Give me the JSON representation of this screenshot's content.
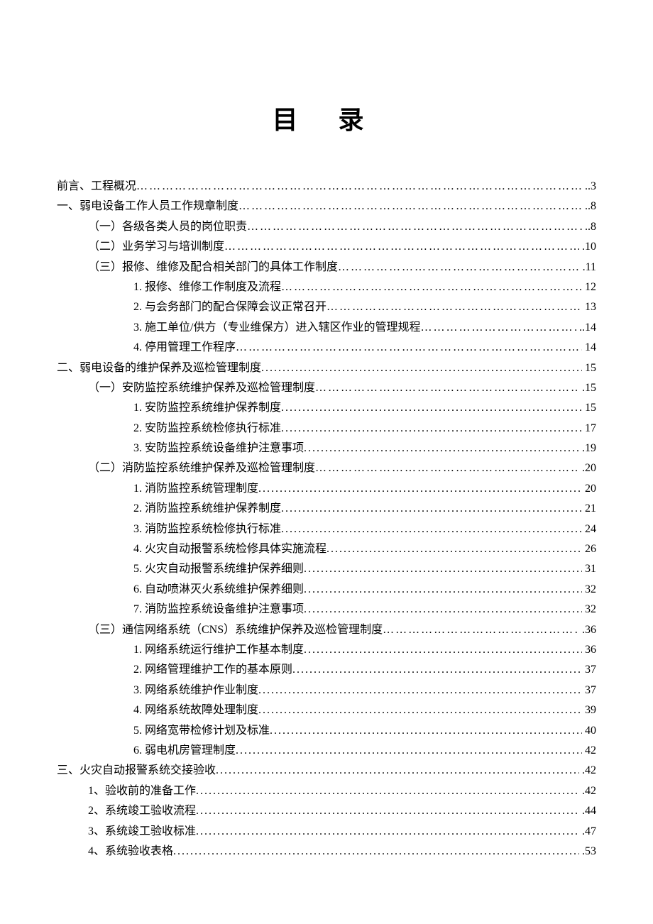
{
  "title": "目 录",
  "entries": [
    {
      "level": 0,
      "text": "前言、工程概况",
      "page": "3",
      "leader": "…",
      "pgprefix": ".."
    },
    {
      "level": 0,
      "text": "一、弱电设备工作人员工作规章制度",
      "page": "8",
      "leader": "…",
      "pgprefix": ".."
    },
    {
      "level": 1,
      "text": "（一）各级各类人员的岗位职责",
      "page": "8",
      "leader": "…",
      "pgprefix": ".."
    },
    {
      "level": 1,
      "text": "（二）业务学习与培训制度",
      "page": "10",
      "leader": "…",
      "pgprefix": "."
    },
    {
      "level": 1,
      "text": "（三）报修、维修及配合相关部门的具体工作制度",
      "page": "11",
      "leader": "…",
      "pgprefix": "."
    },
    {
      "level": 2,
      "text": "1.  报修、维修工作制度及流程",
      "page": "12",
      "leader": "…",
      "pgprefix": " "
    },
    {
      "level": 2,
      "text": "2.  与会务部门的配合保障会议正常召开",
      "page": "13",
      "leader": "…",
      "pgprefix": " "
    },
    {
      "level": 2,
      "text": "3.  施工单位/供方（专业维保方）进入辖区作业的管理规程",
      "page": "14",
      "leader": "…",
      "pgprefix": ".."
    },
    {
      "level": 2,
      "text": "4.  停用管理工作程序",
      "page": "14",
      "leader": "…",
      "pgprefix": " "
    },
    {
      "level": 0,
      "text": "二、弱电设备的维护保养及巡检管理制度",
      "page": "15",
      "leader": ".",
      "pgprefix": " "
    },
    {
      "level": 1,
      "text": "（一）安防监控系统维护保养及巡检管理制度",
      "page": "15",
      "leader": "…",
      "pgprefix": "."
    },
    {
      "level": 2,
      "text": "1.  安防监控系统维护保养制度",
      "page": "15",
      "leader": ".",
      "pgprefix": " "
    },
    {
      "level": 2,
      "text": "2.  安防监控系统检修执行标准",
      "page": "17",
      "leader": ".",
      "pgprefix": " "
    },
    {
      "level": 2,
      "text": "3.  安防监控系统设备维护注意事项",
      "page": "19",
      "leader": ".",
      "pgprefix": "."
    },
    {
      "level": 1,
      "text": "（二）消防监控系统维护保养及巡检管理制度",
      "page": "20",
      "leader": "…",
      "pgprefix": "."
    },
    {
      "level": 2,
      "text": "1.  消防监控系统管理制度",
      "page": "20",
      "leader": ".",
      "pgprefix": " "
    },
    {
      "level": 2,
      "text": "2.  消防监控系统维护保养制度",
      "page": "21",
      "leader": ".",
      "pgprefix": " "
    },
    {
      "level": 2,
      "text": "3.  消防监控系统检修执行标准",
      "page": "24",
      "leader": ".",
      "pgprefix": " "
    },
    {
      "level": 2,
      "text": "4.  火灾自动报警系统检修具体实施流程",
      "page": "26",
      "leader": ".",
      "pgprefix": " "
    },
    {
      "level": 2,
      "text": "5.  火灾自动报警系统维护保养细则",
      "page": "31",
      "leader": ".",
      "pgprefix": " "
    },
    {
      "level": 2,
      "text": "6.  自动喷淋灭火系统维护保养细则",
      "page": "32",
      "leader": ".",
      "pgprefix": " "
    },
    {
      "level": 2,
      "text": "7.  消防监控系统设备维护注意事项",
      "page": "32",
      "leader": ".",
      "pgprefix": " "
    },
    {
      "level": 1,
      "text": "（三）通信网络系统（CNS）系统维护保养及巡检管理制度",
      "page": "36",
      "leader": "…",
      "pgprefix": "."
    },
    {
      "level": 2,
      "text": "1.  网络系统运行维护工作基本制度",
      "page": "36",
      "leader": ".",
      "pgprefix": " "
    },
    {
      "level": 2,
      "text": "2.  网络管理维护工作的基本原则",
      "page": "37",
      "leader": ".",
      "pgprefix": " "
    },
    {
      "level": 2,
      "text": "3.  网络系统维护作业制度",
      "page": "37",
      "leader": ".",
      "pgprefix": " "
    },
    {
      "level": 2,
      "text": "4.  网络系统故障处理制度",
      "page": "39",
      "leader": ".",
      "pgprefix": " "
    },
    {
      "level": 2,
      "text": "5.  网络宽带检修计划及标准",
      "page": "40",
      "leader": ".",
      "pgprefix": " "
    },
    {
      "level": 2,
      "text": "6.  弱电机房管理制度",
      "page": "42",
      "leader": ".",
      "pgprefix": " "
    },
    {
      "level": 0,
      "text": "三、火灾自动报警系统交接验收",
      "page": "42",
      "leader": ".",
      "pgprefix": "."
    },
    {
      "level": 1,
      "text": "1、验收前的准备工作",
      "page": "42",
      "leader": ".",
      "pgprefix": "."
    },
    {
      "level": 1,
      "text": "2、系统竣工验收流程",
      "page": "44",
      "leader": ".",
      "pgprefix": "."
    },
    {
      "level": 1,
      "text": "3、系统竣工验收标准",
      "page": "47",
      "leader": ".",
      "pgprefix": "."
    },
    {
      "level": 1,
      "text": "4、系统验收表格",
      "page": "53",
      "leader": ".",
      "pgprefix": "."
    }
  ]
}
